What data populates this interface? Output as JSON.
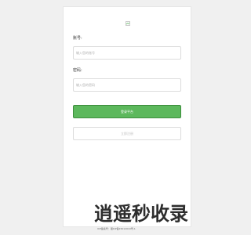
{
  "logo": {
    "icon": "broken-image-icon"
  },
  "account": {
    "label": "账号:",
    "placeholder": "输入您的账号"
  },
  "password": {
    "label": "密码:",
    "placeholder": "输入您的密码"
  },
  "login_button": {
    "label": "登录平台"
  },
  "register_button": {
    "label": "立即注册"
  },
  "watermark": {
    "text": "逍遥秒收录"
  },
  "footer": {
    "text": "ICP备案号：湘ICP备15012010号-1"
  },
  "colors": {
    "primary": "#5cb85c",
    "primary_border": "#3e8e3e",
    "background": "#f0f0f0"
  }
}
